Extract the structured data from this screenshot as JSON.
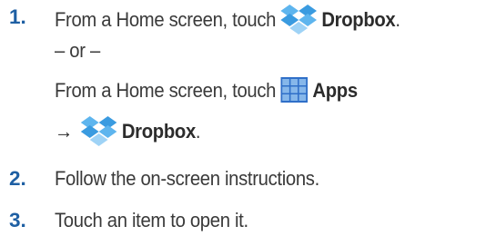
{
  "steps": [
    {
      "number": "1.",
      "line1_prefix": "From a Home screen, touch ",
      "line1_bold": "Dropbox",
      "line1_suffix": ".",
      "or_text": "– or –",
      "line3_prefix": "From a Home screen, touch ",
      "line3_bold": "Apps",
      "line4_arrow": "→",
      "line4_bold": "Dropbox",
      "line4_suffix": "."
    },
    {
      "number": "2.",
      "text": "Follow the on-screen instructions."
    },
    {
      "number": "3.",
      "text": "Touch an item to open it."
    }
  ],
  "icons": {
    "dropbox": "dropbox-icon",
    "apps": "apps-grid-icon"
  },
  "colors": {
    "numbers": "#1e5fa3",
    "dropbox_blue": "#3a9be0",
    "apps_blue": "#2f6fc8"
  }
}
